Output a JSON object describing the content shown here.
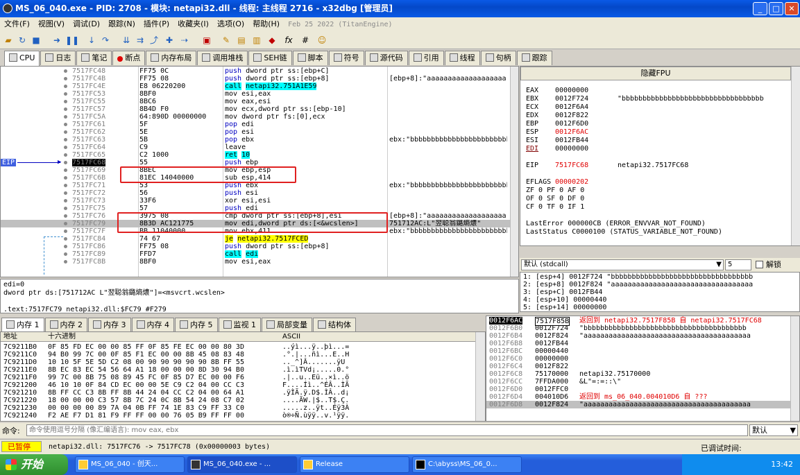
{
  "window": {
    "title": "MS_06_040.exe - PID: 2708 - 模块: netapi32.dll - 线程: 主线程 2716 - x32dbg [管理员]"
  },
  "menu": [
    "文件(F)",
    "视图(V)",
    "调试(D)",
    "跟踪(N)",
    "插件(P)",
    "收藏夹(I)",
    "选项(O)",
    "帮助(H)"
  ],
  "build_date": "Feb 25 2022  (TitanEngine)",
  "tabs": [
    "CPU",
    "日志",
    "笔记",
    "断点",
    "内存布局",
    "调用堆栈",
    "SEH链",
    "脚本",
    "符号",
    "源代码",
    "引用",
    "线程",
    "句柄",
    "跟踪"
  ],
  "eip_label": "EIP",
  "disasm": [
    {
      "a": "7517FC48",
      "b": "FF75 0C",
      "d": "push dword ptr ss:[ebp+C]",
      "c": ""
    },
    {
      "a": "7517FC4B",
      "b": "FF75 08",
      "d": "push dword ptr ss:[ebp+8]",
      "c": "[ebp+8]:\"aaaaaaaaaaaaaaaaaaa"
    },
    {
      "a": "7517FC4E",
      "b": "E8 06220200",
      "d": "call netapi32.751A1E59",
      "c": ""
    },
    {
      "a": "7517FC53",
      "b": "8BF0",
      "d": "mov esi,eax",
      "c": ""
    },
    {
      "a": "7517FC55",
      "b": "8BC6",
      "d": "mov eax,esi",
      "c": ""
    },
    {
      "a": "7517FC57",
      "b": "8B4D F0",
      "d": "mov ecx,dword ptr ss:[ebp-10]",
      "c": ""
    },
    {
      "a": "7517FC5A",
      "b": "64:890D 00000000",
      "d": "mov dword ptr fs:[0],ecx",
      "c": ""
    },
    {
      "a": "7517FC61",
      "b": "5F",
      "d": "pop edi",
      "c": ""
    },
    {
      "a": "7517FC62",
      "b": "5E",
      "d": "pop esi",
      "c": ""
    },
    {
      "a": "7517FC63",
      "b": "5B",
      "d": "pop ebx",
      "c": "ebx:\"bbbbbbbbbbbbbbbbbbbbbbbbbb"
    },
    {
      "a": "7517FC64",
      "b": "C9",
      "d": "leave",
      "c": ""
    },
    {
      "a": "7517FC65",
      "b": "C2 1000",
      "d": "ret 10",
      "c": ""
    },
    {
      "a": "7517FC68",
      "b": "55",
      "d": "push ebp",
      "c": ""
    },
    {
      "a": "7517FC69",
      "b": "8BEC",
      "d": "mov ebp,esp",
      "c": ""
    },
    {
      "a": "7517FC6B",
      "b": "81EC 14040000",
      "d": "sub esp,414",
      "c": ""
    },
    {
      "a": "7517FC71",
      "b": "53",
      "d": "push ebx",
      "c": "ebx:\"bbbbbbbbbbbbbbbbbbbbbbbbbb"
    },
    {
      "a": "7517FC72",
      "b": "56",
      "d": "push esi",
      "c": ""
    },
    {
      "a": "7517FC73",
      "b": "33F6",
      "d": "xor esi,esi",
      "c": ""
    },
    {
      "a": "7517FC75",
      "b": "57",
      "d": "push edi",
      "c": ""
    },
    {
      "a": "7517FC76",
      "b": "3975 08",
      "d": "cmp dword ptr ss:[ebp+8],esi",
      "c": "[ebp+8]:\"aaaaaaaaaaaaaaaaaaa"
    },
    {
      "a": "7517FC79",
      "b": "8B3D AC121775",
      "d": "mov edi,dword ptr ds:[<&wcslen>]",
      "c": "751712AC:L\"翌聪翁鏴熵燶\""
    },
    {
      "a": "7517FC7F",
      "b": "BB 11040000",
      "d": "mov ebx,411",
      "c": "ebx:\"bbbbbbbbbbbbbbbbbbbbbbbbbb"
    },
    {
      "a": "7517FC84",
      "b": "74 67",
      "d": "je netapi32.7517FCED",
      "c": ""
    },
    {
      "a": "7517FC86",
      "b": "FF75 08",
      "d": "push dword ptr ss:[ebp+8]",
      "c": ""
    },
    {
      "a": "7517FC89",
      "b": "FFD7",
      "d": "call edi",
      "c": ""
    },
    {
      "a": "7517FC8B",
      "b": "8BF0",
      "d": "mov esi,eax",
      "c": ""
    }
  ],
  "fpu_header": "隐藏FPU",
  "registers": [
    {
      "n": "EAX",
      "v": "00000000",
      "c": ""
    },
    {
      "n": "EBX",
      "v": "0012F724",
      "c": "\"bbbbbbbbbbbbbbbbbbbbbbbbbbbbbbbbbb"
    },
    {
      "n": "ECX",
      "v": "0012F6A4",
      "c": ""
    },
    {
      "n": "EDX",
      "v": "0012F822",
      "c": ""
    },
    {
      "n": "EBP",
      "v": "0012F6D0",
      "c": ""
    },
    {
      "n": "ESP",
      "v": "0012F6AC",
      "c": ""
    },
    {
      "n": "ESI",
      "v": "0012FB44",
      "c": ""
    },
    {
      "n": "EDI",
      "v": "00000000",
      "c": ""
    }
  ],
  "eip_reg": {
    "n": "EIP",
    "v": "7517FC68",
    "c": "netapi32.7517FC68"
  },
  "eflags": {
    "n": "EFLAGS",
    "v": "00000202"
  },
  "flags": [
    "ZF 0  PF 0  AF 0",
    "OF 0  SF 0  DF 0",
    "CF 0  TF 0  IF 1"
  ],
  "last_error": "LastError   000000CB (ERROR_ENVVAR_NOT_FOUND)",
  "last_status": "LastStatus  C0000100 (STATUS_VARIABLE_NOT_FOUND)",
  "callconv": "默认 (stdcall)",
  "argcount": "5",
  "unlock": "解锁",
  "args": [
    "1: [esp+4]  0012F724 \"bbbbbbbbbbbbbbbbbbbbbbbbbbbbbbbbbb",
    "2: [esp+8]  0012F824 \"aaaaaaaaaaaaaaaaaaaaaaaaaaaaaaaaaa",
    "3: [esp+C]  0012FB44",
    "4: [esp+10] 00000440",
    "5: [esp+14] 00000000"
  ],
  "info": [
    "edi=0",
    "dword ptr ds:[751712AC L\"翌聪翁鏴熵燶\"]=<msvcrt.wcslen>",
    "",
    ".text:7517FC79 netapi32.dll:$FC79 #F279"
  ],
  "dump_tabs": [
    "内存 1",
    "内存 2",
    "内存 3",
    "内存 4",
    "内存 5",
    "监视 1",
    "局部变量",
    "结构体"
  ],
  "dump_head": {
    "addr": "地址",
    "hex": "十六进制",
    "ascii": "ASCII"
  },
  "dump": [
    {
      "a": "7C9211B0",
      "h": "0F 85 FD EC 00 00 85 FF 0F 85 FE EC 00 00 80 3D",
      "s": "..ýì...ÿ..þì...="
    },
    {
      "a": "7C9211C0",
      "h": "94 B0 99 7C 00 0F 85 F1 EC 00 00 8B 45 08 83 48",
      "s": ".°.|...ñì...E..H"
    },
    {
      "a": "7C9211D0",
      "h": "10 10 5F 5E 5D C2 08 00 90 90 90 90 90 8B FF 55",
      "s": ".._^]Â.......ÿU"
    },
    {
      "a": "7C9211E0",
      "h": "8B EC 83 EC 54 56 64 A1 18 00 00 00 8D 30 94 B0",
      "s": ".ì.ìTVd¡.....0.°"
    },
    {
      "a": "7C9211F0",
      "h": "99 7C 00 8B 75 08 89 45 FC 0F 85 D7 EC 00 00 F6",
      "s": ".|..u..Eü..×ì..ö"
    },
    {
      "a": "7C921200",
      "h": "46 10 10 0F 84 CD EC 00 00 5E C9 C2 04 00 CC C3",
      "s": "F....Íì..^ÉÂ..ÌÃ"
    },
    {
      "a": "7C921210",
      "h": "8B FF CC C3 8B FF 8B 44 24 04 CC C2 04 00 64 A1",
      "s": ".ÿÌÃ.ÿ.D$.ÌÂ..d¡"
    },
    {
      "a": "7C921220",
      "h": "18 00 00 00 C3 57 8B 7C 24 0C 8B 54 24 08 C7 02",
      "s": "....ÃW.|$..T$.Ç."
    },
    {
      "a": "7C921230",
      "h": "00 00 00 00 89 7A 04 0B FF 74 1E 83 C9 FF 33 C0",
      "s": ".....z..ÿt..Éÿ3À"
    },
    {
      "a": "7C921240",
      "h": "F2 AE F7 D1 81 F9 FF FF 00 00 76 05 B9 FF FF 00",
      "s": "ò®÷Ñ.ùÿÿ..v.¹ÿÿ."
    }
  ],
  "stack": [
    {
      "a": "0012F6AC",
      "v": "7517F85B",
      "c": "返回到 netapi32.7517F85B 自 netapi32.7517FC68"
    },
    {
      "a": "0012F6B0",
      "v": "0012F724",
      "c": "\"bbbbbbbbbbbbbbbbbbbbbbbbbbbbbbbbbbbbbbb"
    },
    {
      "a": "0012F6B4",
      "v": "0012F824",
      "c": "\"aaaaaaaaaaaaaaaaaaaaaaaaaaaaaaaaaaaaaaaa"
    },
    {
      "a": "0012F6B8",
      "v": "0012FB44",
      "c": ""
    },
    {
      "a": "0012F6BC",
      "v": "00000440",
      "c": ""
    },
    {
      "a": "0012F6C0",
      "v": "00000000",
      "c": ""
    },
    {
      "a": "0012F6C4",
      "v": "0012F822",
      "c": ""
    },
    {
      "a": "0012F6C8",
      "v": "75170000",
      "c": "netapi32.75170000"
    },
    {
      "a": "0012F6CC",
      "v": "7FFDA000",
      "c": "&L\"=:=::\\\""
    },
    {
      "a": "0012F6D0",
      "v": "0012FFC0",
      "c": ""
    },
    {
      "a": "0012F6D4",
      "v": "004010D6",
      "c": "返回到 ms_06_040.004010D6 自 ???"
    },
    {
      "a": "0012F6D8",
      "v": "0012F824",
      "c": "\"aaaaaaaaaaaaaaaaaaaaaaaaaaaaaaaaaaaaaaaa"
    }
  ],
  "cmd": {
    "label": "命令:",
    "placeholder": "命令使用逗号分隔 (像汇编语言): mov eax, ebx",
    "right": "默认"
  },
  "status": {
    "state": "已暂停",
    "text": "netapi32.dll: 7517FC76 -> 7517FC78 (0x00000003 bytes)",
    "time": "已调试时间:"
  },
  "taskbar": {
    "start": "开始",
    "items": [
      "MS_06_040 - 创天...",
      "MS_06_040.exe - ...",
      "Release",
      "C:\\abyss\\MS_06_0..."
    ],
    "clock": "13:42"
  },
  "colors": {
    "title": "#0a5ae6",
    "red_box": "#e02020",
    "paused": "#ffff00"
  }
}
